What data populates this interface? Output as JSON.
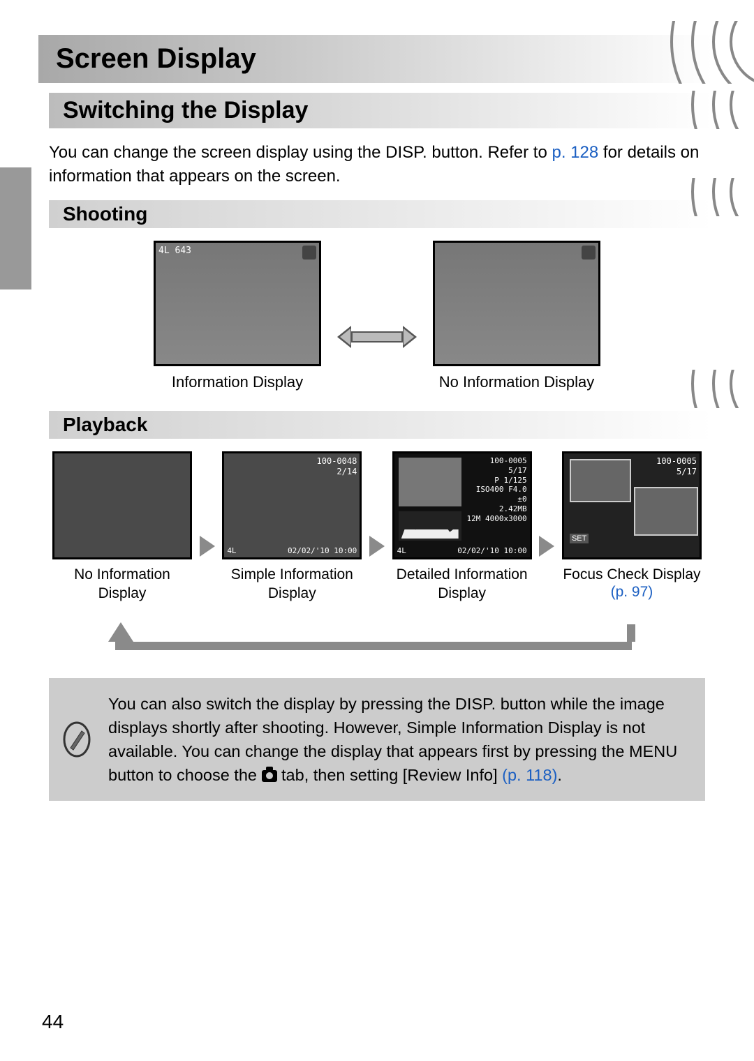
{
  "page_number": "44",
  "heading_main": "Screen Display",
  "heading_sub": "Switching the Display",
  "intro": {
    "part1": "You can change the screen display using the ",
    "disp_glyph": "DISP.",
    "part2": " button. Refer to ",
    "link": "p. 128",
    "part3": " for details on information that appears on the screen."
  },
  "shooting": {
    "heading": "Shooting",
    "left_caption": "Information Display",
    "right_caption": "No Information Display",
    "overlay_text": "       4L  643"
  },
  "playback": {
    "heading": "Playback",
    "items": [
      {
        "caption": "No Information Display",
        "link": ""
      },
      {
        "caption": "Simple Information Display",
        "link": ""
      },
      {
        "caption": "Detailed Information Display",
        "link": ""
      },
      {
        "caption": "Focus Check Display",
        "link": "(p. 97)"
      }
    ],
    "simple_overlay": {
      "file": "100-0048",
      "count": "2/14",
      "date": "02/02/'10  10:00"
    },
    "detailed_overlay": {
      "file": "100-0005",
      "count": "5/17",
      "mode": "P      1/125",
      "iso": "ISO400   F4.0",
      "ev": "    ±0",
      "size_mb": "2.42MB",
      "res": "12M 4000x3000",
      "date": "02/02/'10  10:00",
      "bl": "4L"
    },
    "focus_overlay": {
      "file": "100-0005",
      "count": "5/17",
      "set": "SET"
    }
  },
  "note": {
    "part1": "You can also switch the display by pressing the ",
    "disp_glyph": "DISP.",
    "part2": " button while the image displays shortly after shooting. However, Simple Information Display is not available. You can change the display that appears first by pressing the ",
    "menu_glyph": "MENU",
    "part3": " button to choose the ",
    "part4": " tab, then setting [Review Info] ",
    "link": "(p. 118)",
    "part5": "."
  }
}
